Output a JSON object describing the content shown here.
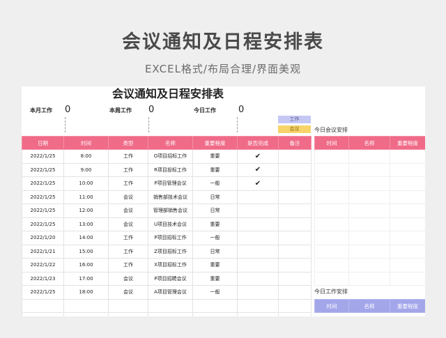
{
  "hero": {
    "title": "会议通知及日程安排表",
    "subtitle": "EXCEL格式/布局合理/界面美观"
  },
  "sheet": {
    "title": "会议通知及日程安排表",
    "stats": [
      {
        "label": "本月工作",
        "value": "0"
      },
      {
        "label": "本周工作",
        "value": "0"
      },
      {
        "label": "今日工作",
        "value": "0"
      }
    ],
    "legend": {
      "work": "工作",
      "meeting": "会议"
    },
    "colors": {
      "header_pink": "#ef6b88",
      "header_purple": "#a4a6ea",
      "work": "#c5c8f5",
      "meeting": "#f7d36a"
    },
    "main_table": {
      "headers": [
        "日期",
        "时间",
        "类型",
        "名称",
        "重要程度",
        "是否完成",
        "备注"
      ],
      "rows": [
        [
          "2022/1/25",
          "8:00",
          "工作",
          "O项目招标工作",
          "重要",
          "✔",
          ""
        ],
        [
          "2022/1/25",
          "9:00",
          "工作",
          "R项目投标工作",
          "重要",
          "✔",
          ""
        ],
        [
          "2022/1/25",
          "10:00",
          "工作",
          "P项目管理会议",
          "一般",
          "✔",
          ""
        ],
        [
          "2022/1/25",
          "11:00",
          "会议",
          "销售部技术会议",
          "日常",
          "",
          ""
        ],
        [
          "2022/1/25",
          "12:00",
          "会议",
          "管理部销售会议",
          "日常",
          "",
          ""
        ],
        [
          "2022/1/25",
          "13:00",
          "会议",
          "U项目技术会议",
          "重要",
          "",
          ""
        ],
        [
          "2022/1/20",
          "14:00",
          "工作",
          "P项目招标工作",
          "一般",
          "",
          ""
        ],
        [
          "2022/1/21",
          "15:00",
          "工作",
          "Z项目招标工作",
          "日常",
          "",
          ""
        ],
        [
          "2022/1/22",
          "16:00",
          "工作",
          "X项目招标工作",
          "重要",
          "",
          ""
        ],
        [
          "2022/1/23",
          "17:00",
          "会议",
          "P项目招聘会议",
          "重要",
          "",
          ""
        ],
        [
          "2022/1/25",
          "18:00",
          "会议",
          "A项目管理会议",
          "一般",
          "",
          ""
        ],
        [
          "",
          "",
          "",
          "",
          "",
          "",
          ""
        ],
        [
          "",
          "",
          "",
          "",
          "",
          "",
          ""
        ]
      ]
    },
    "today_meetings": {
      "title": "今日会议安排",
      "headers": [
        "时间",
        "名称",
        "重要程度"
      ]
    },
    "today_work": {
      "title": "今日工作安排",
      "headers": [
        "时间",
        "名称",
        "重要程度"
      ]
    }
  }
}
